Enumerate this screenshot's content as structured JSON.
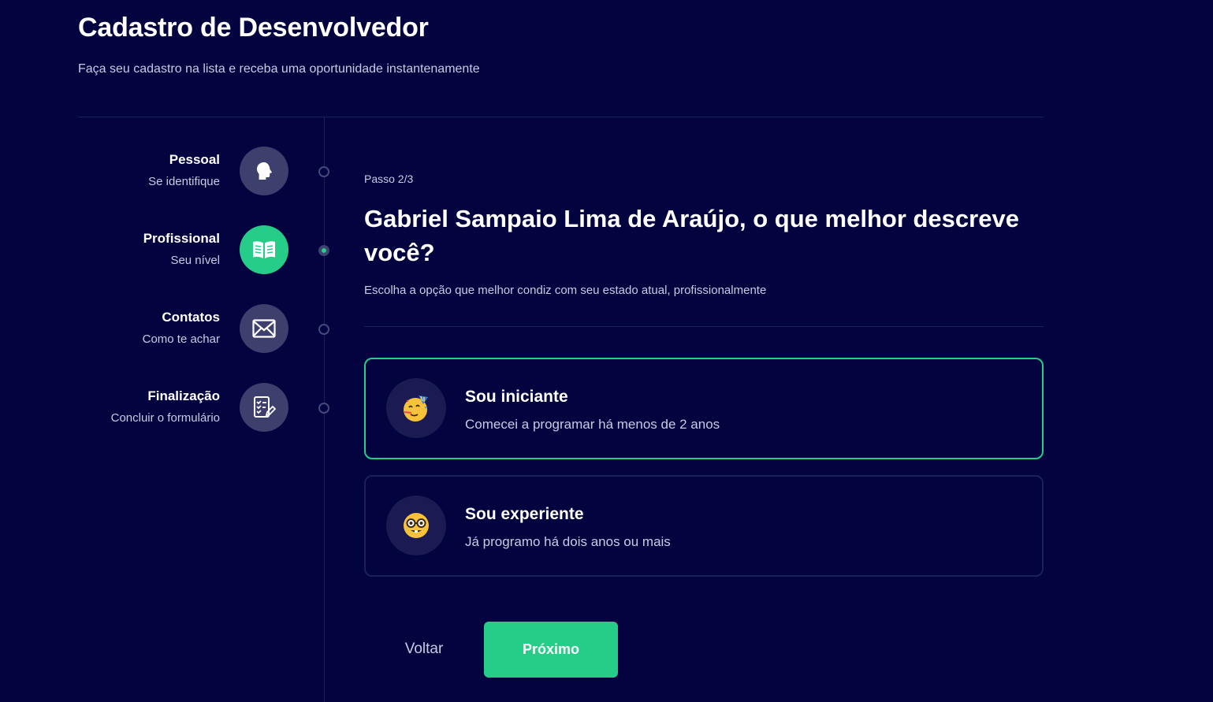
{
  "header": {
    "title": "Cadastro de Desenvolvedor",
    "subtitle": "Faça seu cadastro na lista e receba uma oportunidade instantenamente"
  },
  "steps": [
    {
      "label": "Pessoal",
      "desc": "Se identifique",
      "icon": "head-icon",
      "active": false
    },
    {
      "label": "Profissional",
      "desc": "Seu nível",
      "icon": "book-icon",
      "active": true
    },
    {
      "label": "Contatos",
      "desc": "Como te achar",
      "icon": "mail-icon",
      "active": false
    },
    {
      "label": "Finalização",
      "desc": "Concluir o formulário",
      "icon": "checklist-icon",
      "active": false
    }
  ],
  "main": {
    "step_counter": "Passo 2/3",
    "question": "Gabriel Sampaio Lima de Araújo, o que melhor descreve você?",
    "hint": "Escolha a opção que melhor condiz com seu estado atual, profissionalmente"
  },
  "options": [
    {
      "title": "Sou iniciante",
      "desc": "Comecei a programar há menos de 2 anos",
      "icon": "party-face-emoji-icon",
      "selected": true
    },
    {
      "title": "Sou experiente",
      "desc": "Já programo há dois anos ou mais",
      "icon": "nerd-face-emoji-icon",
      "selected": false
    }
  ],
  "actions": {
    "back_label": "Voltar",
    "next_label": "Próximo"
  },
  "colors": {
    "background": "#02033f",
    "accent": "#26cd89",
    "muted_text": "#c9cbe3",
    "step_icon_bg": "#3d3f6d"
  }
}
